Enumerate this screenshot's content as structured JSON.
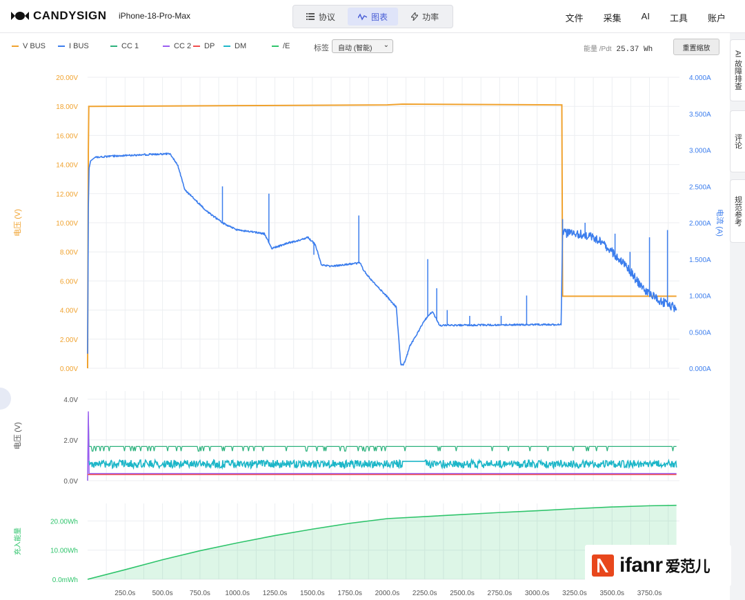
{
  "app": {
    "brand": "CANDYSIGN",
    "device": "iPhone-18-Pro-Max",
    "tabs": [
      {
        "label": "协议",
        "icon": "list-icon"
      },
      {
        "label": "图表",
        "icon": "chart-line-icon",
        "active": true
      },
      {
        "label": "功率",
        "icon": "bolt-icon"
      }
    ],
    "menu": [
      "文件",
      "采集",
      "AI",
      "工具",
      "账户"
    ],
    "side_tabs": [
      "AI 故障排查",
      "评论",
      "规范参考"
    ],
    "watermark": {
      "text": "ifanr",
      "cn": "爱范儿"
    },
    "accent": "#4a5fd6"
  },
  "toolbar": {
    "label_word": "标签",
    "select_value": "自动 (智能)",
    "energy_label": "能量 /Pdt",
    "energy_value": "25.37 Wh",
    "reset_label": "重置缩放"
  },
  "chart_data": [
    {
      "type": "line",
      "legend": [
        {
          "name": "V BUS",
          "color": "#f0a22e"
        },
        {
          "name": "I BUS",
          "color": "#3b7ded"
        },
        {
          "name": "CC 1",
          "color": "#2bb17c"
        },
        {
          "name": "CC 2",
          "color": "#9a5cf0"
        },
        {
          "name": "DP",
          "color": "#f04c4c"
        },
        {
          "name": "DM",
          "color": "#1db6c8"
        },
        {
          "name": "/E",
          "color": "#2ec46b"
        }
      ],
      "ylabel": "电压 (V)",
      "y2label": "电流 (A)",
      "ylim": [
        0,
        20
      ],
      "y2lim": [
        0,
        4
      ],
      "yticks": [
        "0.00V",
        "2.00V",
        "4.00V",
        "6.00V",
        "8.00V",
        "10.00V",
        "12.00V",
        "14.00V",
        "16.00V",
        "18.00V",
        "20.00V"
      ],
      "y2ticks": [
        "0.000A",
        "0.500A",
        "1.000A",
        "1.500A",
        "2.000A",
        "2.500A",
        "3.000A",
        "3.500A",
        "4.000A"
      ],
      "xlim": [
        0,
        3950
      ],
      "grid": true,
      "series": [
        {
          "name": "V BUS",
          "color": "#f0a22e",
          "x": [
            0,
            5,
            8,
            30,
            1000,
            2000,
            2100,
            3150,
            3165,
            3170,
            3500,
            3930
          ],
          "y": [
            0,
            15,
            18,
            18.0,
            18.05,
            18.1,
            18.15,
            18.1,
            18.1,
            4.95,
            4.95,
            4.95
          ]
        },
        {
          "name": "I BUS",
          "color": "#3b7ded",
          "x": [
            0,
            5,
            10,
            20,
            50,
            200,
            550,
            600,
            650,
            700,
            800,
            900,
            1000,
            1180,
            1230,
            1280,
            1330,
            1400,
            1470,
            1520,
            1560,
            1620,
            1700,
            1820,
            1840,
            1900,
            2000,
            2060,
            2090,
            2105,
            2120,
            2150,
            2250,
            2300,
            2350,
            2400,
            3000,
            3150,
            3160,
            3170,
            3300,
            3400,
            3500,
            3600,
            3700,
            3800,
            3930
          ],
          "y": [
            0.2,
            2.2,
            2.75,
            2.85,
            2.9,
            2.92,
            2.95,
            2.8,
            2.45,
            2.35,
            2.15,
            2.0,
            1.9,
            1.85,
            1.65,
            1.68,
            1.72,
            1.75,
            1.8,
            1.7,
            1.42,
            1.4,
            1.42,
            1.45,
            1.35,
            1.2,
            0.98,
            0.84,
            0.05,
            0.05,
            0.1,
            0.3,
            0.66,
            0.78,
            0.59,
            0.59,
            0.6,
            0.6,
            0.6,
            1.86,
            1.84,
            1.78,
            1.6,
            1.4,
            1.1,
            0.95,
            0.82
          ],
          "spikes": [
            {
              "x": 650,
              "y": 2.45
            },
            {
              "x": 900,
              "y": 2.5
            },
            {
              "x": 1210,
              "y": 2.4
            },
            {
              "x": 1510,
              "y": 1.56
            },
            {
              "x": 1810,
              "y": 2.1
            },
            {
              "x": 2270,
              "y": 1.5
            },
            {
              "x": 2330,
              "y": 1.1
            },
            {
              "x": 2400,
              "y": 0.8
            },
            {
              "x": 2550,
              "y": 0.72
            },
            {
              "x": 2760,
              "y": 0.72
            },
            {
              "x": 2930,
              "y": 1.0
            },
            {
              "x": 3170,
              "y": 2.05
            },
            {
              "x": 3320,
              "y": 2.0
            },
            {
              "x": 3520,
              "y": 1.85
            },
            {
              "x": 3620,
              "y": 1.6
            },
            {
              "x": 3750,
              "y": 1.8
            },
            {
              "x": 3870,
              "y": 1.9
            }
          ]
        }
      ]
    },
    {
      "type": "line",
      "ylabel": "电压 (V)",
      "ylim": [
        0,
        4.4
      ],
      "yticks": [
        "0.0V",
        "2.0V",
        "4.0V"
      ],
      "xlim": [
        0,
        3950
      ],
      "grid": true,
      "series": [
        {
          "name": "CC 1",
          "color": "#2bb17c",
          "x": [
            0,
            5,
            10,
            3930
          ],
          "y": [
            0,
            3.2,
            1.7,
            1.65
          ]
        },
        {
          "name": "CC 2",
          "color": "#9a5cf0",
          "x": [
            0,
            5,
            10,
            3930
          ],
          "y": [
            0,
            3.4,
            0.35,
            0.35
          ]
        },
        {
          "name": "DM",
          "color": "#1db6c8",
          "x": [
            0,
            10,
            2100,
            2250,
            3930
          ],
          "y": [
            0,
            0.85,
            0.85,
            0.0,
            0.85
          ]
        },
        {
          "name": "DP",
          "color": "#f04c4c",
          "x": [
            0,
            3930
          ],
          "y": [
            0.3,
            0.3
          ]
        }
      ]
    },
    {
      "type": "area",
      "ylabel": "充入能量",
      "ylim": [
        0,
        26
      ],
      "yticks": [
        "0.0mWh",
        "10.00Wh",
        "20.00Wh"
      ],
      "xlim": [
        0,
        3950
      ],
      "xticks": [
        "250.0s",
        "500.0s",
        "750.0s",
        "1000.0s",
        "1250.0s",
        "1500.0s",
        "1750.0s",
        "2000.0s",
        "2250.0s",
        "2500.0s",
        "2750.0s",
        "3000.0s",
        "3250.0s",
        "3500.0s",
        "3750.0s"
      ],
      "grid": true,
      "series": [
        {
          "name": "/E",
          "color": "#2ec46b",
          "x": [
            0,
            250,
            500,
            750,
            1000,
            1250,
            1500,
            1750,
            2000,
            2250,
            2500,
            2750,
            3000,
            3250,
            3500,
            3750,
            3930
          ],
          "y": [
            0,
            3.3,
            6.7,
            9.8,
            12.5,
            15.0,
            17.2,
            19.2,
            20.8,
            21.5,
            22.2,
            22.9,
            23.5,
            24.2,
            24.8,
            25.2,
            25.37
          ]
        }
      ]
    }
  ]
}
